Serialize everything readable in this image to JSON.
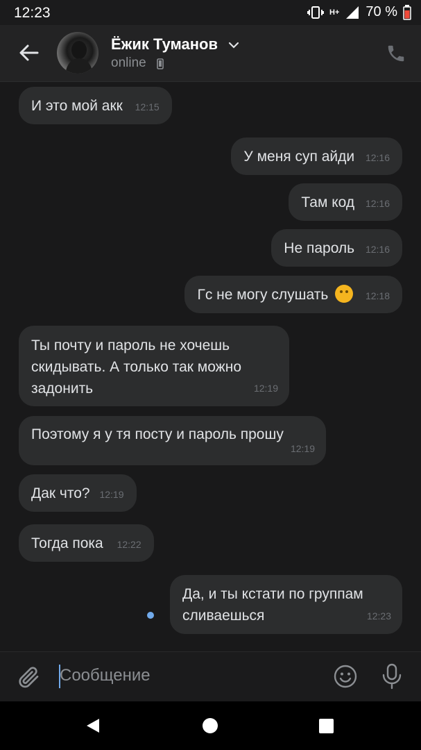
{
  "status_bar": {
    "time": "12:23",
    "network": "H+",
    "battery": "70 %"
  },
  "header": {
    "name": "Ёжик Туманов",
    "status": "online"
  },
  "messages": [
    {
      "dir": "in",
      "text": "И это мой акк",
      "time": "12:15"
    },
    {
      "dir": "out",
      "text": "У меня суп айди",
      "time": "12:16"
    },
    {
      "dir": "out",
      "text": "Там код",
      "time": "12:16"
    },
    {
      "dir": "out",
      "text": "Не пароль",
      "time": "12:16"
    },
    {
      "dir": "out",
      "text": "Гс не могу слушать",
      "emoji": "upside-down-face",
      "time": "12:18"
    },
    {
      "dir": "in",
      "lines": [
        "Ты почту и пароль не хочешь",
        "скидывать. А только так можно",
        "задонить"
      ],
      "time": "12:19"
    },
    {
      "dir": "in",
      "text": "Поэтому я у тя посту и пароль прошу",
      "time": "12:19"
    },
    {
      "dir": "in",
      "text": "Дак что?",
      "time": "12:19"
    },
    {
      "dir": "in",
      "text": "Тогда пока",
      "time": "12:22"
    },
    {
      "dir": "out",
      "lines": [
        "Да, и ты кстати по группам",
        "сливаешься"
      ],
      "time": "12:23",
      "unread": true
    }
  ],
  "composer": {
    "placeholder": "Сообщение"
  },
  "colors": {
    "bg": "#19191a",
    "bubble": "#2c2d2e",
    "accent": "#71aaeb"
  }
}
